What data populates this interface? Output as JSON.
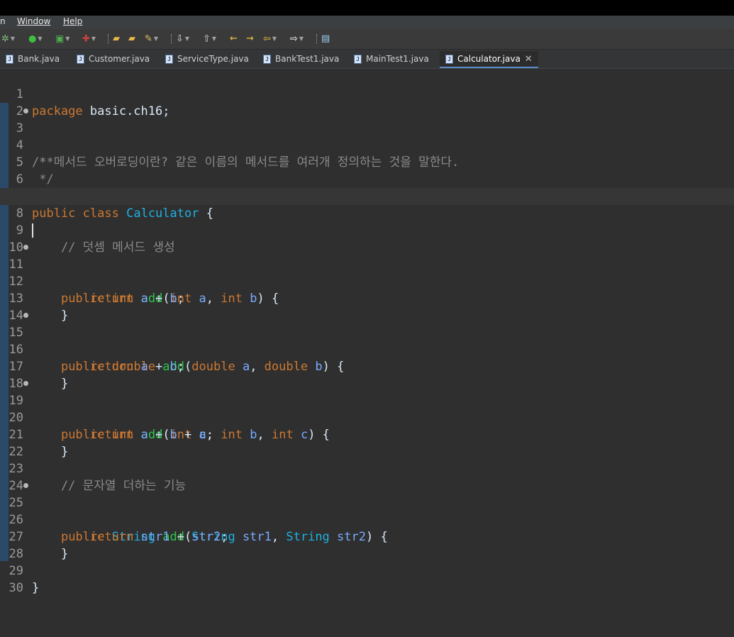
{
  "menu": {
    "cut": "n",
    "window": "Window",
    "help": "Help"
  },
  "toolbar": {
    "icons": [
      "debug-icon",
      "run-icon",
      "coverage-icon",
      "external-tools-icon",
      "open-type-icon",
      "open-folder-icon",
      "edit-pen-icon",
      "next-annotation-icon",
      "prev-annotation-icon",
      "back-edit-icon",
      "forward-edit-icon",
      "back-icon",
      "forward-icon",
      "open-console-icon"
    ]
  },
  "tabs": [
    {
      "label": "Bank.java"
    },
    {
      "label": "Customer.java"
    },
    {
      "label": "ServiceType.java"
    },
    {
      "label": "BankTest1.java"
    },
    {
      "label": "MainTest1.java"
    },
    {
      "label": "Calculator.java",
      "active": true
    }
  ],
  "editor": {
    "line_numbers": [
      "1",
      "2",
      "3",
      "4",
      "5",
      "6",
      "7",
      "8",
      "9",
      "10",
      "11",
      "12",
      "13",
      "14",
      "15",
      "16",
      "17",
      "18",
      "19",
      "20",
      "21",
      "22",
      "23",
      "24",
      "25",
      "26",
      "27",
      "28",
      "29",
      "30"
    ],
    "current_line": "8",
    "code": {
      "l1": {
        "kw": "package",
        "rest": " basic.ch16;"
      },
      "l3": "/**",
      "l4": " * 메서드 오버로딩이란? 같은 이름의 메서드를 여러개 정의하는 것을 말한다.",
      "l5": " */",
      "l7": {
        "kw1": "public",
        "kw2": "class",
        "cls": "Calculator",
        "rest": " {"
      },
      "l9": "    // 덧셈 메서드 생성",
      "l11": {
        "indent": "    ",
        "kw1": "public",
        "type": "int",
        "fn": "add",
        "p1type": "int",
        "p1": "a",
        "p2type": "int",
        "p2": "b",
        "end": ") {"
      },
      "l12": {
        "indent": "        ",
        "kw": "return",
        "a": "a",
        "op": " + ",
        "b": "b",
        "end": ";"
      },
      "l13": "    }",
      "l15": {
        "indent": "    ",
        "kw1": "public",
        "type": "double",
        "fn": "add",
        "p1type": "double",
        "p1": "a",
        "p2type": "double",
        "p2": "b",
        "end": ") {"
      },
      "l16": {
        "indent": "        ",
        "kw": "return",
        "a": "a",
        "op": " + ",
        "b": "b",
        "end": ";"
      },
      "l17": "    }",
      "l19": {
        "indent": "    ",
        "kw1": "public",
        "type": "int",
        "fn": "add",
        "p1type": "int",
        "p1": "a",
        "p2type": "int",
        "p2": "b",
        "p3type": "int",
        "p3": "c",
        "end": ") {"
      },
      "l20": {
        "indent": "        ",
        "kw": "return",
        "a": "a",
        "op1": " + ",
        "b": "b",
        "op2": " + ",
        "c": "c",
        "end": ";"
      },
      "l21": "    }",
      "l23": "    // 문자열 더하는 기능",
      "l25": {
        "indent": "    ",
        "kw1": "public",
        "type": "String",
        "fn": "add",
        "p1type": "String",
        "p1": "str1",
        "p2type": "String",
        "p2": "str2",
        "end": ") {"
      },
      "l26": {
        "indent": "        ",
        "kw": "return",
        "a": "str1",
        "op": " + ",
        "b": "str2",
        "end": ";"
      },
      "l27": "    }",
      "l29": "}"
    }
  }
}
